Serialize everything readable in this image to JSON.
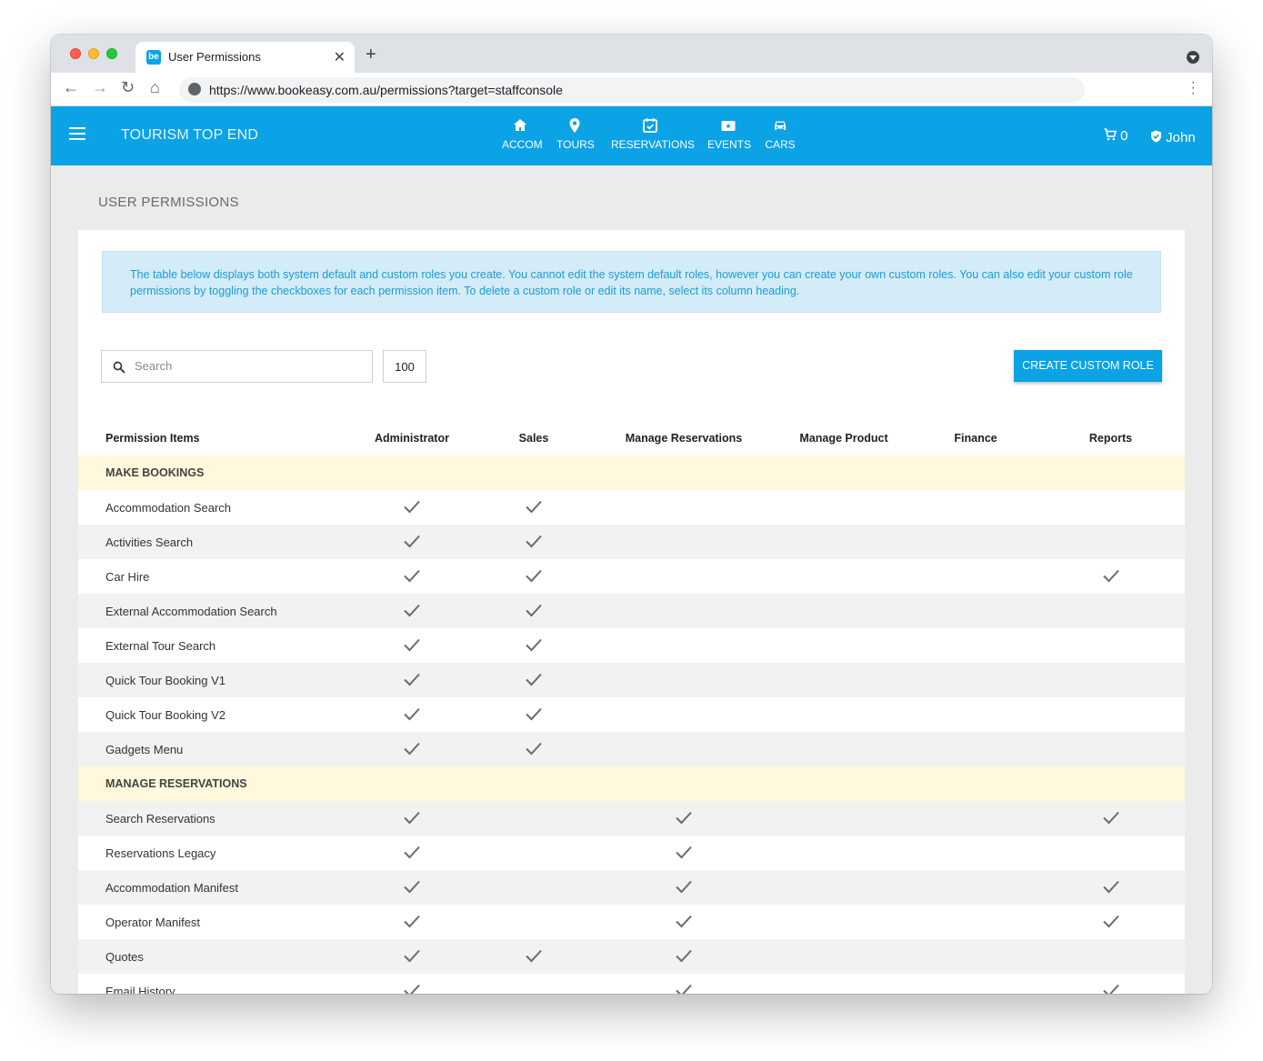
{
  "browser": {
    "tab_title": "User Permissions",
    "favicon_text": "be",
    "url": "https://www.bookeasy.com.au/permissions?target=staffconsole"
  },
  "header": {
    "brand": "TOURISM TOP END",
    "nav": [
      {
        "label": "ACCOM",
        "icon": "home-icon"
      },
      {
        "label": "TOURS",
        "icon": "map-pin-icon"
      },
      {
        "label": "RESERVATIONS",
        "icon": "calendar-check-icon"
      },
      {
        "label": "EVENTS",
        "icon": "ticket-icon"
      },
      {
        "label": "CARS",
        "icon": "car-icon"
      }
    ],
    "cart_count": "0",
    "user_name": "John"
  },
  "page": {
    "title": "USER PERMISSIONS",
    "info": "The table below displays both system default and custom roles you create. You cannot edit the system default roles, however you can create your own custom roles. You can also edit your custom role permissions by toggling the checkboxes for each permission item. To delete a custom role or edit its name, select its column heading.",
    "search_placeholder": "Search",
    "page_size": "100",
    "create_button": "CREATE CUSTOM ROLE"
  },
  "table": {
    "columns": [
      "Permission Items",
      "Administrator",
      "Sales",
      "Manage Reservations",
      "Manage Product",
      "Finance",
      "Reports"
    ],
    "groups": [
      {
        "name": "MAKE BOOKINGS",
        "rows": [
          {
            "label": "Accommodation Search",
            "checks": [
              true,
              true,
              false,
              false,
              false,
              false
            ]
          },
          {
            "label": "Activities Search",
            "checks": [
              true,
              true,
              false,
              false,
              false,
              false
            ]
          },
          {
            "label": "Car Hire",
            "checks": [
              true,
              true,
              false,
              false,
              false,
              true
            ]
          },
          {
            "label": "External Accommodation Search",
            "checks": [
              true,
              true,
              false,
              false,
              false,
              false
            ]
          },
          {
            "label": "External Tour Search",
            "checks": [
              true,
              true,
              false,
              false,
              false,
              false
            ]
          },
          {
            "label": "Quick Tour Booking V1",
            "checks": [
              true,
              true,
              false,
              false,
              false,
              false
            ]
          },
          {
            "label": "Quick Tour Booking V2",
            "checks": [
              true,
              true,
              false,
              false,
              false,
              false
            ]
          },
          {
            "label": "Gadgets Menu",
            "checks": [
              true,
              true,
              false,
              false,
              false,
              false
            ]
          }
        ]
      },
      {
        "name": "MANAGE RESERVATIONS",
        "rows": [
          {
            "label": "Search Reservations",
            "checks": [
              true,
              false,
              true,
              false,
              false,
              true
            ]
          },
          {
            "label": "Reservations Legacy",
            "checks": [
              true,
              false,
              true,
              false,
              false,
              false
            ]
          },
          {
            "label": "Accommodation Manifest",
            "checks": [
              true,
              false,
              true,
              false,
              false,
              true
            ]
          },
          {
            "label": "Operator Manifest",
            "checks": [
              true,
              false,
              true,
              false,
              false,
              true
            ]
          },
          {
            "label": "Quotes",
            "checks": [
              true,
              true,
              true,
              false,
              false,
              false
            ]
          },
          {
            "label": "Email History",
            "checks": [
              true,
              false,
              true,
              false,
              false,
              true
            ]
          }
        ]
      }
    ]
  },
  "colors": {
    "brand": "#0ba2e6",
    "group_row": "#fff8dc",
    "alt_row": "#f2f2f2",
    "info_bg": "#d3ecf8"
  }
}
